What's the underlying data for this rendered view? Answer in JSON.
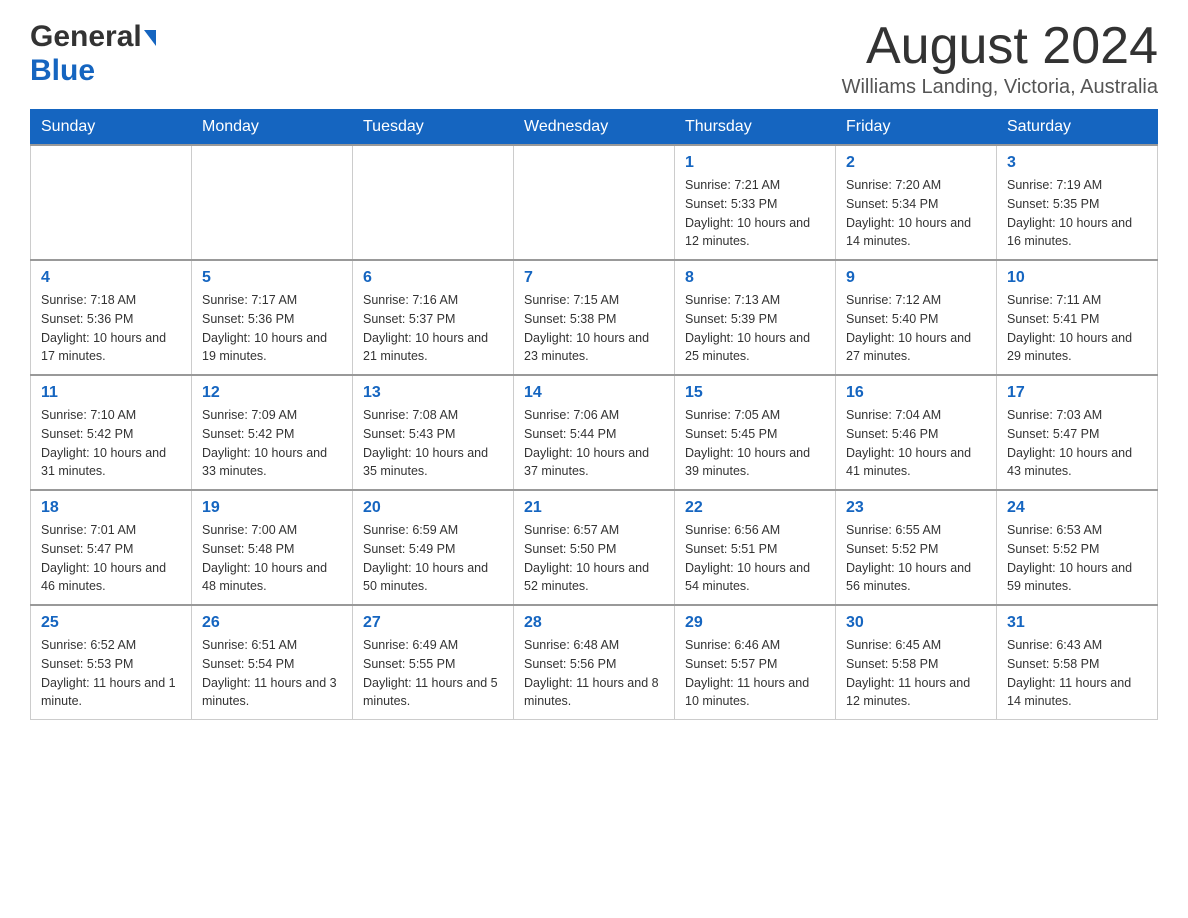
{
  "header": {
    "logo_general": "General",
    "logo_blue": "Blue",
    "main_title": "August 2024",
    "subtitle": "Williams Landing, Victoria, Australia"
  },
  "calendar": {
    "days_of_week": [
      "Sunday",
      "Monday",
      "Tuesday",
      "Wednesday",
      "Thursday",
      "Friday",
      "Saturday"
    ],
    "weeks": [
      [
        {
          "day": "",
          "sunrise": "",
          "sunset": "",
          "daylight": ""
        },
        {
          "day": "",
          "sunrise": "",
          "sunset": "",
          "daylight": ""
        },
        {
          "day": "",
          "sunrise": "",
          "sunset": "",
          "daylight": ""
        },
        {
          "day": "",
          "sunrise": "",
          "sunset": "",
          "daylight": ""
        },
        {
          "day": "1",
          "sunrise": "Sunrise: 7:21 AM",
          "sunset": "Sunset: 5:33 PM",
          "daylight": "Daylight: 10 hours and 12 minutes."
        },
        {
          "day": "2",
          "sunrise": "Sunrise: 7:20 AM",
          "sunset": "Sunset: 5:34 PM",
          "daylight": "Daylight: 10 hours and 14 minutes."
        },
        {
          "day": "3",
          "sunrise": "Sunrise: 7:19 AM",
          "sunset": "Sunset: 5:35 PM",
          "daylight": "Daylight: 10 hours and 16 minutes."
        }
      ],
      [
        {
          "day": "4",
          "sunrise": "Sunrise: 7:18 AM",
          "sunset": "Sunset: 5:36 PM",
          "daylight": "Daylight: 10 hours and 17 minutes."
        },
        {
          "day": "5",
          "sunrise": "Sunrise: 7:17 AM",
          "sunset": "Sunset: 5:36 PM",
          "daylight": "Daylight: 10 hours and 19 minutes."
        },
        {
          "day": "6",
          "sunrise": "Sunrise: 7:16 AM",
          "sunset": "Sunset: 5:37 PM",
          "daylight": "Daylight: 10 hours and 21 minutes."
        },
        {
          "day": "7",
          "sunrise": "Sunrise: 7:15 AM",
          "sunset": "Sunset: 5:38 PM",
          "daylight": "Daylight: 10 hours and 23 minutes."
        },
        {
          "day": "8",
          "sunrise": "Sunrise: 7:13 AM",
          "sunset": "Sunset: 5:39 PM",
          "daylight": "Daylight: 10 hours and 25 minutes."
        },
        {
          "day": "9",
          "sunrise": "Sunrise: 7:12 AM",
          "sunset": "Sunset: 5:40 PM",
          "daylight": "Daylight: 10 hours and 27 minutes."
        },
        {
          "day": "10",
          "sunrise": "Sunrise: 7:11 AM",
          "sunset": "Sunset: 5:41 PM",
          "daylight": "Daylight: 10 hours and 29 minutes."
        }
      ],
      [
        {
          "day": "11",
          "sunrise": "Sunrise: 7:10 AM",
          "sunset": "Sunset: 5:42 PM",
          "daylight": "Daylight: 10 hours and 31 minutes."
        },
        {
          "day": "12",
          "sunrise": "Sunrise: 7:09 AM",
          "sunset": "Sunset: 5:42 PM",
          "daylight": "Daylight: 10 hours and 33 minutes."
        },
        {
          "day": "13",
          "sunrise": "Sunrise: 7:08 AM",
          "sunset": "Sunset: 5:43 PM",
          "daylight": "Daylight: 10 hours and 35 minutes."
        },
        {
          "day": "14",
          "sunrise": "Sunrise: 7:06 AM",
          "sunset": "Sunset: 5:44 PM",
          "daylight": "Daylight: 10 hours and 37 minutes."
        },
        {
          "day": "15",
          "sunrise": "Sunrise: 7:05 AM",
          "sunset": "Sunset: 5:45 PM",
          "daylight": "Daylight: 10 hours and 39 minutes."
        },
        {
          "day": "16",
          "sunrise": "Sunrise: 7:04 AM",
          "sunset": "Sunset: 5:46 PM",
          "daylight": "Daylight: 10 hours and 41 minutes."
        },
        {
          "day": "17",
          "sunrise": "Sunrise: 7:03 AM",
          "sunset": "Sunset: 5:47 PM",
          "daylight": "Daylight: 10 hours and 43 minutes."
        }
      ],
      [
        {
          "day": "18",
          "sunrise": "Sunrise: 7:01 AM",
          "sunset": "Sunset: 5:47 PM",
          "daylight": "Daylight: 10 hours and 46 minutes."
        },
        {
          "day": "19",
          "sunrise": "Sunrise: 7:00 AM",
          "sunset": "Sunset: 5:48 PM",
          "daylight": "Daylight: 10 hours and 48 minutes."
        },
        {
          "day": "20",
          "sunrise": "Sunrise: 6:59 AM",
          "sunset": "Sunset: 5:49 PM",
          "daylight": "Daylight: 10 hours and 50 minutes."
        },
        {
          "day": "21",
          "sunrise": "Sunrise: 6:57 AM",
          "sunset": "Sunset: 5:50 PM",
          "daylight": "Daylight: 10 hours and 52 minutes."
        },
        {
          "day": "22",
          "sunrise": "Sunrise: 6:56 AM",
          "sunset": "Sunset: 5:51 PM",
          "daylight": "Daylight: 10 hours and 54 minutes."
        },
        {
          "day": "23",
          "sunrise": "Sunrise: 6:55 AM",
          "sunset": "Sunset: 5:52 PM",
          "daylight": "Daylight: 10 hours and 56 minutes."
        },
        {
          "day": "24",
          "sunrise": "Sunrise: 6:53 AM",
          "sunset": "Sunset: 5:52 PM",
          "daylight": "Daylight: 10 hours and 59 minutes."
        }
      ],
      [
        {
          "day": "25",
          "sunrise": "Sunrise: 6:52 AM",
          "sunset": "Sunset: 5:53 PM",
          "daylight": "Daylight: 11 hours and 1 minute."
        },
        {
          "day": "26",
          "sunrise": "Sunrise: 6:51 AM",
          "sunset": "Sunset: 5:54 PM",
          "daylight": "Daylight: 11 hours and 3 minutes."
        },
        {
          "day": "27",
          "sunrise": "Sunrise: 6:49 AM",
          "sunset": "Sunset: 5:55 PM",
          "daylight": "Daylight: 11 hours and 5 minutes."
        },
        {
          "day": "28",
          "sunrise": "Sunrise: 6:48 AM",
          "sunset": "Sunset: 5:56 PM",
          "daylight": "Daylight: 11 hours and 8 minutes."
        },
        {
          "day": "29",
          "sunrise": "Sunrise: 6:46 AM",
          "sunset": "Sunset: 5:57 PM",
          "daylight": "Daylight: 11 hours and 10 minutes."
        },
        {
          "day": "30",
          "sunrise": "Sunrise: 6:45 AM",
          "sunset": "Sunset: 5:58 PM",
          "daylight": "Daylight: 11 hours and 12 minutes."
        },
        {
          "day": "31",
          "sunrise": "Sunrise: 6:43 AM",
          "sunset": "Sunset: 5:58 PM",
          "daylight": "Daylight: 11 hours and 14 minutes."
        }
      ]
    ]
  }
}
